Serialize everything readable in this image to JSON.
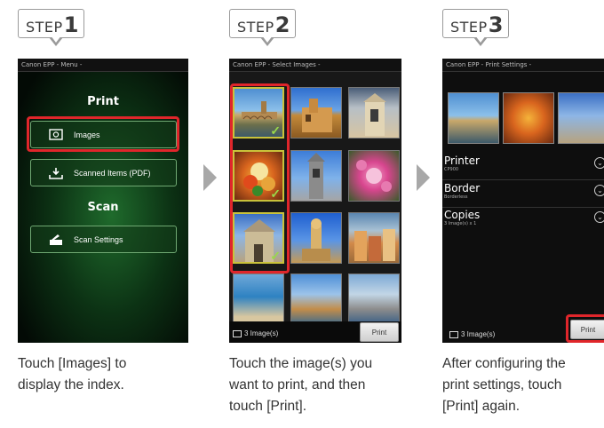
{
  "steps": [
    {
      "word": "STEP",
      "num": "1",
      "caption": [
        "Touch [Images] to",
        "display the index."
      ]
    },
    {
      "word": "STEP",
      "num": "2",
      "caption": [
        "Touch the image(s) you",
        "want to print, and then",
        "touch [Print]."
      ]
    },
    {
      "word": "STEP",
      "num": "3",
      "caption": [
        "After configuring the",
        "print settings, touch",
        "[Print] again."
      ]
    }
  ],
  "screen1": {
    "status": "Canon EPP - Menu -",
    "print_heading": "Print",
    "images_btn": "Images",
    "scanned_btn": "Scanned Items (PDF)",
    "scan_heading": "Scan",
    "scan_settings_btn": "Scan Settings",
    "icons": [
      "image-icon",
      "download-icon",
      "scan-settings-icon"
    ]
  },
  "screen2": {
    "status": "Canon EPP - Select Images -",
    "count": "3 Image(s)",
    "print_btn": "Print"
  },
  "screen3": {
    "status": "Canon EPP - Print Settings -",
    "printer_label": "Printer",
    "printer_value": "CP900",
    "border_label": "Border",
    "border_value": "Borderless",
    "copies_label": "Copies",
    "copies_value": "3 Image(s) x 1",
    "count": "3 Image(s)",
    "print_btn": "Print"
  },
  "colors": {
    "highlight": "#e0262b",
    "selected_border": "#c9c23a",
    "check": "#9ad94a"
  }
}
